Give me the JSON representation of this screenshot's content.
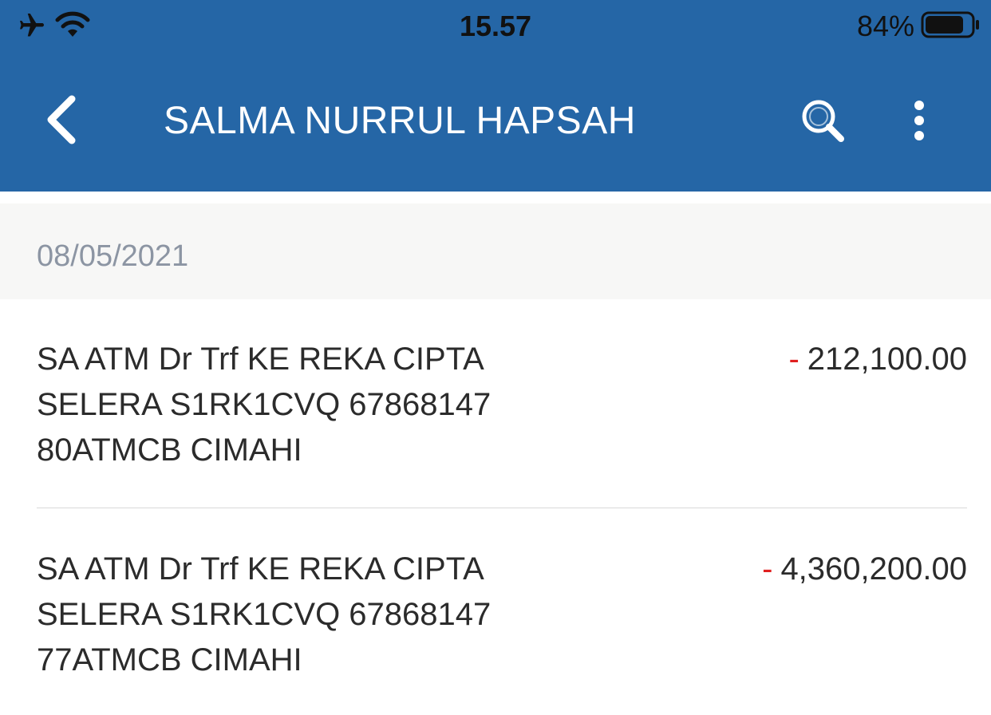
{
  "status_bar": {
    "time": "15.57",
    "battery_percent": "84%",
    "battery_level": 0.84
  },
  "header": {
    "title": "SALMA NURRUL HAPSAH"
  },
  "icons": {
    "back": "chevron-left-icon",
    "search": "search-icon",
    "more": "more-vertical-icon",
    "airplane": "airplane-icon",
    "wifi": "wifi-icon",
    "battery": "battery-icon"
  },
  "date_group": {
    "date": "08/05/2021"
  },
  "transactions": [
    {
      "line1": "SA ATM Dr Trf KE REKA CIPTA",
      "line2": "SELERA S1RK1CVQ 67868147",
      "line3": "80ATMCB CIMAHI",
      "sign": "-",
      "amount": "212,100.00"
    },
    {
      "line1": "SA ATM Dr Trf KE REKA CIPTA",
      "line2": "SELERA S1RK1CVQ 67868147",
      "line3": "77ATMCB CIMAHI",
      "sign": "-",
      "amount": "4,360,200.00"
    }
  ],
  "colors": {
    "header_bg": "#2566a6",
    "debit": "#e02020",
    "date_band": "#f7f7f6",
    "date_text": "#8c95a3"
  }
}
